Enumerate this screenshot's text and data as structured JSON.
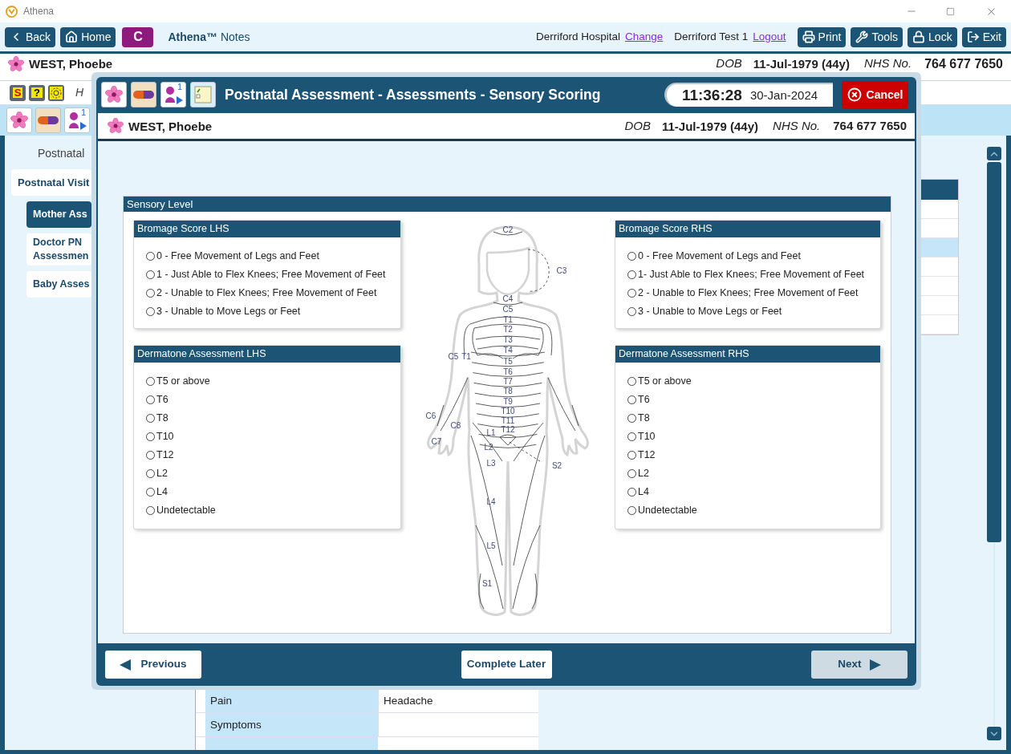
{
  "window": {
    "title": "Athena"
  },
  "toolbar": {
    "left_buttons": [
      {
        "kind": "back",
        "label": "Back"
      },
      {
        "kind": "home",
        "label": "Home"
      }
    ],
    "app_badge": "C",
    "app_name": "Athena™",
    "app_section": "Notes",
    "hospital": "Derriford Hospital",
    "change_link": "Change",
    "user": "Derriford Test 1",
    "logout_link": "Logout",
    "right_buttons": [
      {
        "kind": "print",
        "label": "Print"
      },
      {
        "kind": "tools",
        "label": "Tools"
      },
      {
        "kind": "lock",
        "label": "Lock"
      },
      {
        "kind": "exit",
        "label": "Exit"
      }
    ]
  },
  "patient": {
    "name": "WEST, Phoebe",
    "dob_label": "DOB",
    "dob": "11-Jul-1979 (44y)",
    "nhs_label": "NHS No.",
    "nhs": "764 677 7650"
  },
  "alert_icons": [
    {
      "kind": "hand",
      "glyph": "S"
    },
    {
      "kind": "help",
      "glyph": "?"
    },
    {
      "kind": "sun"
    }
  ],
  "alert_text": "H",
  "record_icons": [
    {
      "kind": "flower"
    },
    {
      "kind": "pill"
    },
    {
      "kind": "person",
      "badge": "1"
    }
  ],
  "sidebar": {
    "heading": "Postnatal",
    "items": [
      {
        "label": "Postnatal Visit",
        "selected": false,
        "children": [
          {
            "label": "Mother Ass",
            "selected": true
          },
          {
            "label": "Doctor PN Assessmen",
            "selected": false
          },
          {
            "label": "Baby Asses",
            "selected": false
          }
        ]
      }
    ]
  },
  "side_table": {
    "rows": [
      {
        "selected": false
      },
      {
        "selected": false
      },
      {
        "selected": true
      },
      {
        "selected": false
      },
      {
        "selected": false
      },
      {
        "selected": false
      },
      {
        "selected": false
      }
    ]
  },
  "detail_table": {
    "rows": [
      {
        "label": "Pain",
        "value": "Headache"
      },
      {
        "label": "Symptoms"
      }
    ]
  },
  "modal": {
    "icons": [
      {
        "kind": "flower"
      },
      {
        "kind": "pill"
      },
      {
        "kind": "person",
        "badge": "1"
      },
      {
        "kind": "notes"
      }
    ],
    "title": "Postnatal Assessment - Assessments - Sensory Scoring",
    "time": "11:36:28",
    "date": "30-Jan-2024",
    "cancel": "Cancel",
    "patient": {
      "name": "WEST, Phoebe",
      "dob_label": "DOB",
      "dob": "11-Jul-1979 (44y)",
      "nhs_label": "NHS No.",
      "nhs": "764 677 7650"
    },
    "section_title": "Sensory Level",
    "left_groups": [
      {
        "title": "Bromage Score LHS",
        "options": [
          {
            "label": "0 - Free Movement of Legs and Feet",
            "selected": false
          },
          {
            "label": "1 - Just Able to Flex Knees; Free Movement of Feet",
            "selected": false
          },
          {
            "label": "2 - Unable to Flex Knees; Free Movement of Feet",
            "selected": false
          },
          {
            "label": "3 - Unable to Move Legs or Feet",
            "selected": false
          }
        ]
      },
      {
        "title": "Dermatone Assessment LHS",
        "options": [
          {
            "label": "T5 or above",
            "selected": false
          },
          {
            "label": "T6",
            "selected": false
          },
          {
            "label": "T8",
            "selected": false
          },
          {
            "label": "T10",
            "selected": false
          },
          {
            "label": "T12",
            "selected": false
          },
          {
            "label": "L2",
            "selected": false
          },
          {
            "label": "L4",
            "selected": false
          },
          {
            "label": "Undetectable",
            "selected": false
          }
        ]
      }
    ],
    "right_groups": [
      {
        "title": "Bromage Score RHS",
        "options": [
          {
            "label": "0 - Free Movement of Legs and Feet",
            "selected": false
          },
          {
            "label": "1- Just Able to Flex Knees; Free Movement of Feet",
            "selected": false
          },
          {
            "label": "2 - Unable to Flex Knees; Free Movement of Feet",
            "selected": false
          },
          {
            "label": "3 - Unable to Move Legs or Feet",
            "selected": false
          }
        ]
      },
      {
        "title": "Dermatone Assessment RHS",
        "options": [
          {
            "label": "T5 or above",
            "selected": false
          },
          {
            "label": "T6",
            "selected": false
          },
          {
            "label": "T8",
            "selected": false
          },
          {
            "label": "T10",
            "selected": false
          },
          {
            "label": "T12",
            "selected": false
          },
          {
            "label": "L2",
            "selected": false
          },
          {
            "label": "L4",
            "selected": false
          },
          {
            "label": "Undetectable",
            "selected": false
          }
        ]
      }
    ],
    "body_map": {
      "labels": [
        "C2",
        "C3",
        "C4",
        "C5",
        "T1",
        "T2",
        "T3",
        "T4",
        "C5",
        "T1",
        "T5",
        "T6",
        "T7",
        "T8",
        "T9",
        "T10",
        "T11",
        "T12",
        "C6",
        "C8",
        "C7",
        "L1",
        "L2",
        "S2",
        "L3",
        "L4",
        "L5",
        "S1"
      ]
    },
    "footer": {
      "previous": "Previous",
      "complete_later": "Complete Later",
      "next": {
        "label": "Next",
        "disabled": true
      }
    }
  }
}
